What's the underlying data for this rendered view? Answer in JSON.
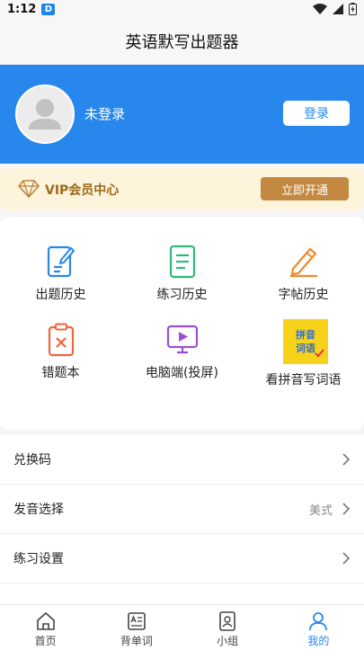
{
  "status_bar": {
    "time": "1:12",
    "app_badge": "D"
  },
  "header": {
    "title": "英语默写出题器"
  },
  "profile": {
    "login_status": "未登录",
    "login_button": "登录"
  },
  "vip": {
    "title": "VIP会员中心",
    "button": "立即开通"
  },
  "features": [
    {
      "label": "出题历史",
      "icon": "document-edit-icon"
    },
    {
      "label": "练习历史",
      "icon": "document-list-icon"
    },
    {
      "label": "字帖历史",
      "icon": "pencil-icon"
    },
    {
      "label": "错题本",
      "icon": "error-book-icon"
    },
    {
      "label": "电脑端(投屏)",
      "icon": "monitor-play-icon"
    },
    {
      "label": "看拼音写词语",
      "icon": "pinyin-icon",
      "badge": "拼音词语"
    }
  ],
  "menu": [
    {
      "label": "兑换码",
      "value": ""
    },
    {
      "label": "发音选择",
      "value": "美式"
    },
    {
      "label": "练习设置",
      "value": ""
    }
  ],
  "tabs": [
    {
      "label": "首页",
      "icon": "home-icon",
      "active": false
    },
    {
      "label": "背单词",
      "icon": "word-card-icon",
      "active": false
    },
    {
      "label": "小组",
      "icon": "group-icon",
      "active": false
    },
    {
      "label": "我的",
      "icon": "user-icon",
      "active": true
    }
  ],
  "colors": {
    "primary": "#2787ec",
    "vip_gold": "#c38943",
    "vip_bg": "#fdf4db"
  }
}
